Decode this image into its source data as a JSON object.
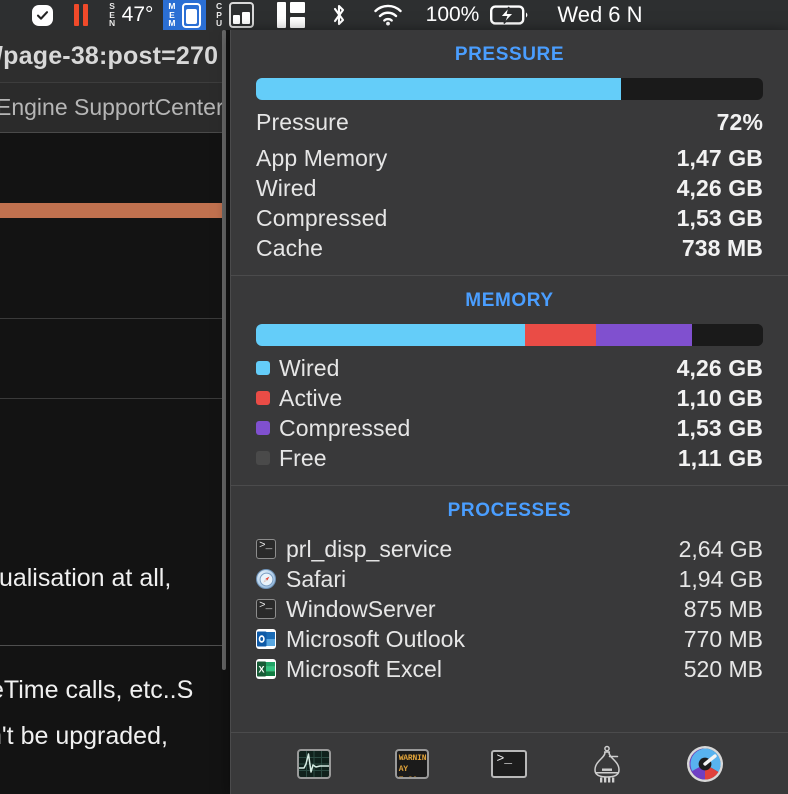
{
  "menubar": {
    "items": [
      {
        "name": "checkmark-status",
        "type": "check"
      },
      {
        "name": "pause-indicator",
        "type": "pause"
      },
      {
        "name": "sensors",
        "type": "vlabel",
        "label": "SEN"
      },
      {
        "name": "temperature",
        "type": "text",
        "label": "47°"
      },
      {
        "name": "memory-indicator",
        "type": "mem",
        "label": "MEM",
        "active": true
      },
      {
        "name": "cpu-indicator",
        "type": "cpu",
        "label": "CPU"
      },
      {
        "name": "window-layout",
        "type": "layout"
      },
      {
        "name": "bluetooth",
        "type": "bluetooth"
      },
      {
        "name": "wifi",
        "type": "wifi"
      }
    ],
    "battery_percent": "100%",
    "clock": "Wed 6 N"
  },
  "background": {
    "url_text": "/page-38:post=270",
    "tab_text": "Engine SupportCenter",
    "line1": "tualisation at all,",
    "line2": "eTime calls, etc..S",
    "line3": "n't be upgraded,"
  },
  "pressure": {
    "title": "PRESSURE",
    "bar": {
      "fill_percent": 72,
      "fill_color": "#64cdf9",
      "track_color": "#1a1a1a"
    },
    "rows": [
      {
        "label": "Pressure",
        "value": "72%"
      },
      {
        "label": "App Memory",
        "value": "1,47 GB"
      },
      {
        "label": "Wired",
        "value": "4,26 GB"
      },
      {
        "label": "Compressed",
        "value": "1,53 GB"
      },
      {
        "label": "Cache",
        "value": "738 MB"
      }
    ]
  },
  "memory": {
    "title": "MEMORY",
    "segments": [
      {
        "color": "#64cdf9",
        "percent": 53
      },
      {
        "color": "#ea4c46",
        "percent": 14
      },
      {
        "color": "#8050cf",
        "percent": 19
      },
      {
        "color": "#1a1a1a",
        "percent": 14
      }
    ],
    "rows": [
      {
        "label": "Wired",
        "value": "4,26 GB",
        "color": "#64cdf9"
      },
      {
        "label": "Active",
        "value": "1,10 GB",
        "color": "#ea4c46"
      },
      {
        "label": "Compressed",
        "value": "1,53 GB",
        "color": "#8050cf"
      },
      {
        "label": "Free",
        "value": "1,11 GB",
        "color": "#4a4a4a"
      }
    ]
  },
  "processes": {
    "title": "PROCESSES",
    "rows": [
      {
        "label": "prl_disp_service",
        "value": "2,64 GB",
        "icon": "terminal-icon"
      },
      {
        "label": "Safari",
        "value": "1,94 GB",
        "icon": "safari-icon"
      },
      {
        "label": "WindowServer",
        "value": "875 MB",
        "icon": "terminal-icon"
      },
      {
        "label": "Microsoft Outlook",
        "value": "770 MB",
        "icon": "outlook-icon"
      },
      {
        "label": "Microsoft Excel",
        "value": "520 MB",
        "icon": "excel-icon"
      }
    ]
  },
  "toolbar": {
    "buttons": [
      {
        "name": "activity-monitor-button",
        "icon": "activity-monitor-icon"
      },
      {
        "name": "console-button",
        "icon": "console-icon",
        "line1": "WARNIN",
        "line2": "AY 7:36"
      },
      {
        "name": "terminal-button",
        "icon": "terminal-icon",
        "glyph": ">_"
      },
      {
        "name": "homebrew-button",
        "icon": "flask-icon"
      },
      {
        "name": "disk-utility-button",
        "icon": "gauge-icon"
      }
    ]
  },
  "colors": {
    "accent_blue": "#4a9eff",
    "panel_bg": "#39393a",
    "menubar_bg": "#2d2f30",
    "highlight_blue": "#2b6fd4"
  }
}
